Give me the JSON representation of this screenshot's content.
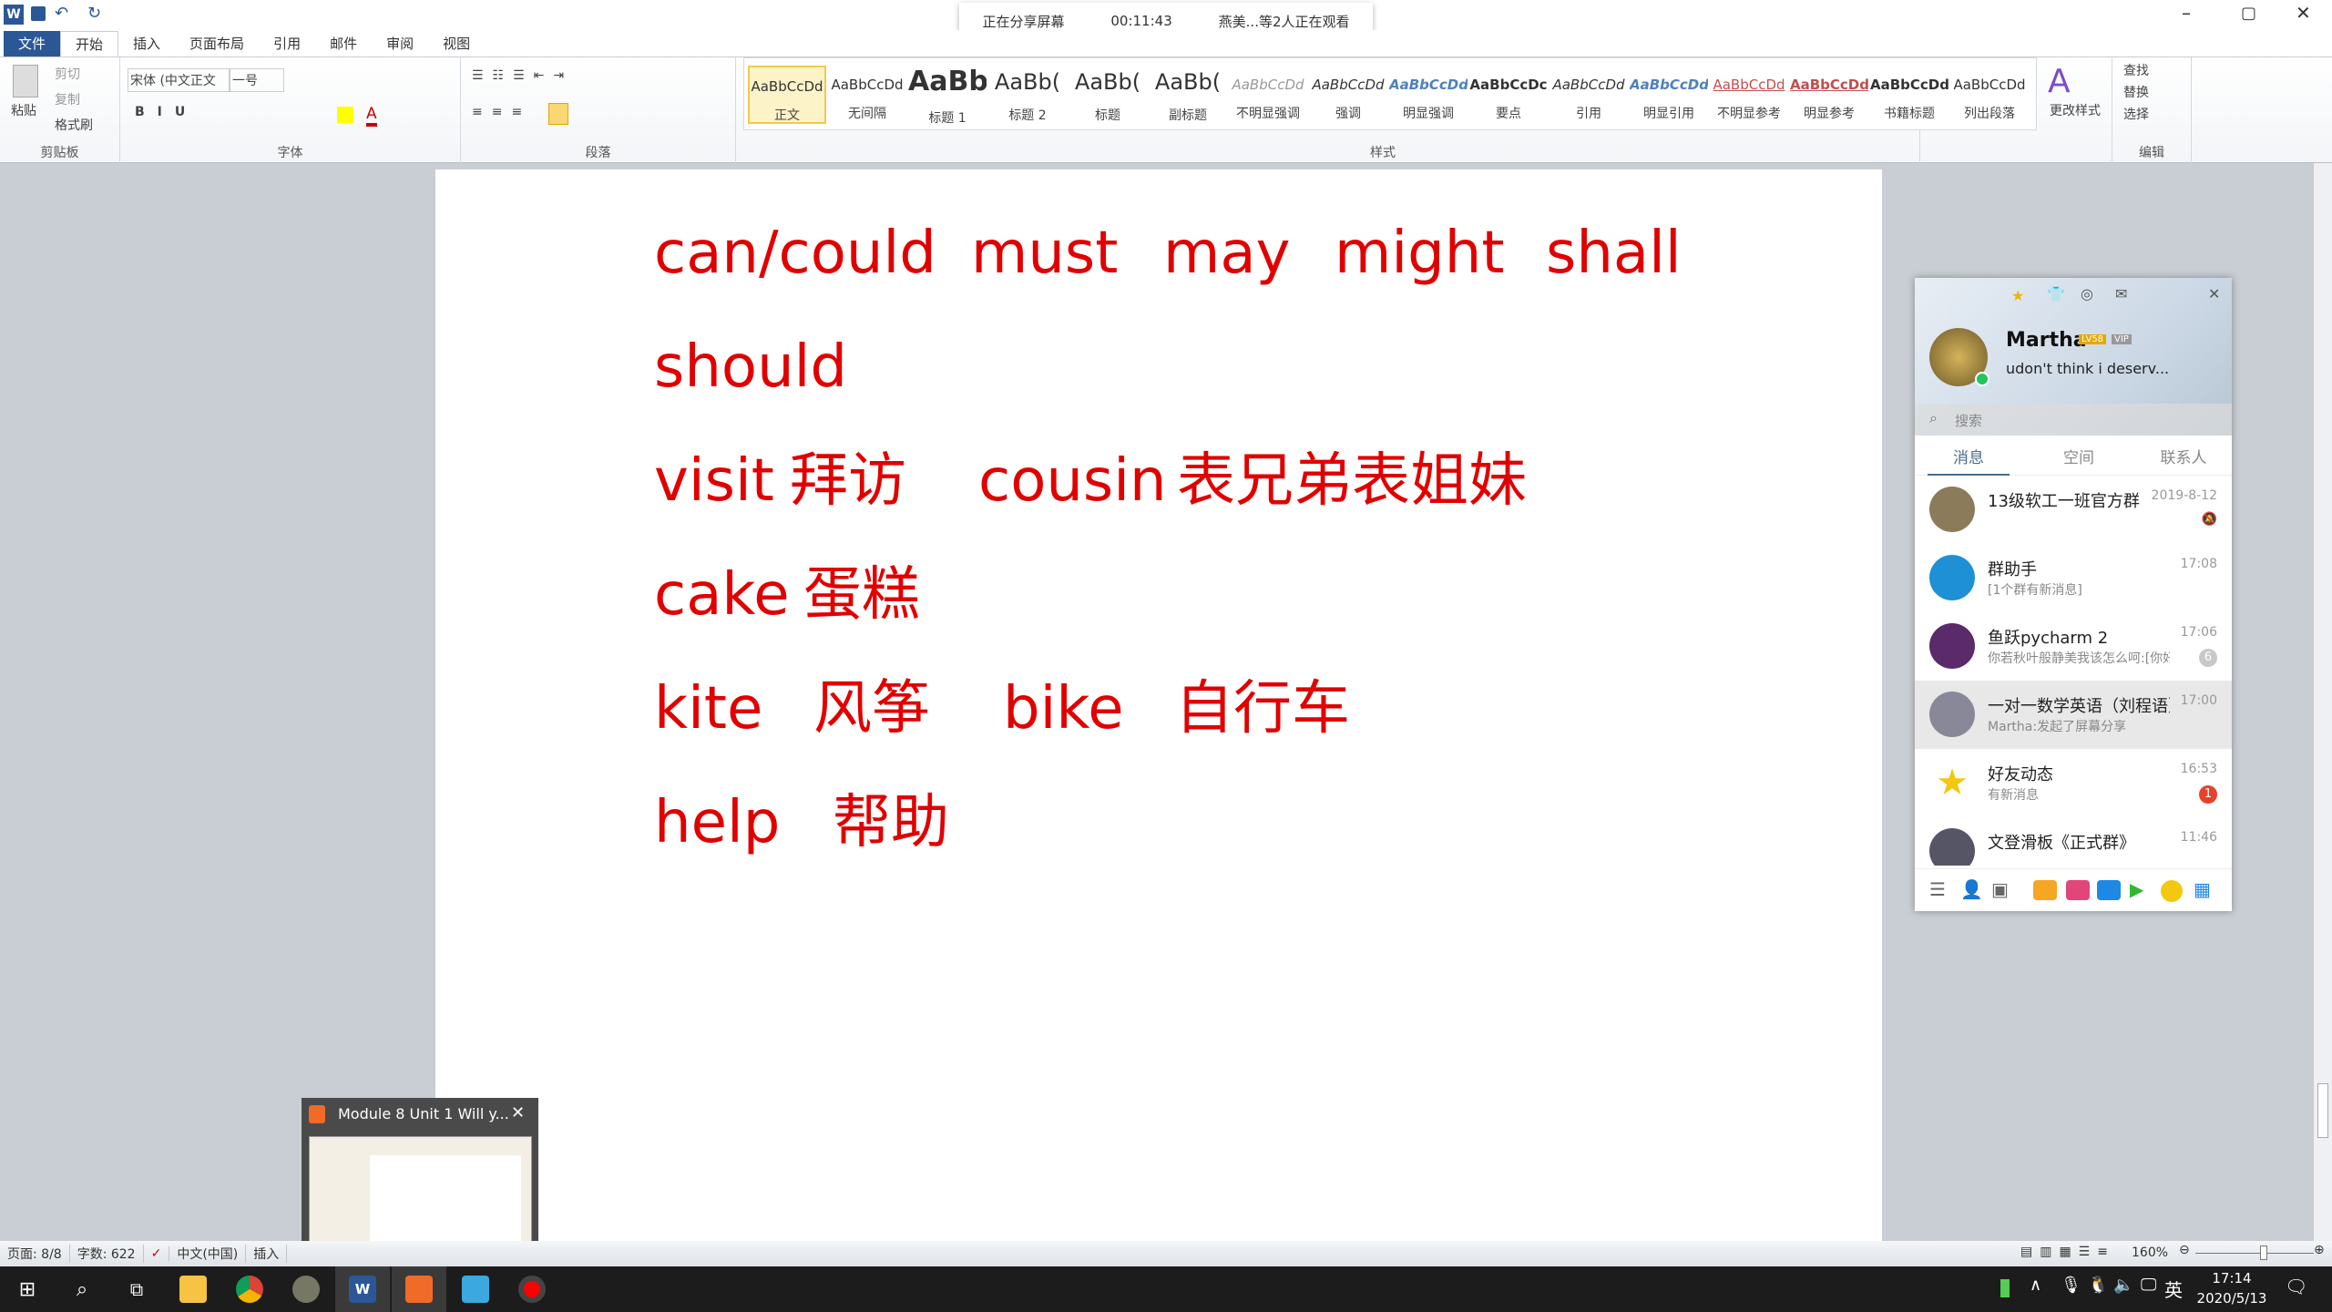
{
  "app": {
    "quick_access": [
      "save",
      "undo",
      "redo",
      "customize"
    ],
    "window_controls": [
      "minimize",
      "restore",
      "close"
    ]
  },
  "share_bar": {
    "status": "正在分享屏幕",
    "timer": "00:11:43",
    "viewers": "燕美...等2人正在观看"
  },
  "tabs": [
    {
      "label": "文件"
    },
    {
      "label": "开始",
      "active": true
    },
    {
      "label": "插入"
    },
    {
      "label": "页面布局"
    },
    {
      "label": "引用"
    },
    {
      "label": "邮件"
    },
    {
      "label": "审阅"
    },
    {
      "label": "视图"
    }
  ],
  "ribbon": {
    "clipboard": {
      "label": "剪贴板",
      "paste": "粘贴",
      "cut": "剪切",
      "copy": "复制",
      "format_painter": "格式刷"
    },
    "font": {
      "label": "字体",
      "font_name": "宋体 (中文正文",
      "font_size": "一号"
    },
    "paragraph": {
      "label": "段落"
    },
    "styles": {
      "label": "样式",
      "items": [
        {
          "sample": "AaBbCcDd",
          "name": "正文",
          "selected": true
        },
        {
          "sample": "AaBbCcDd",
          "name": "无间隔"
        },
        {
          "sample": "AaBb",
          "name": "标题 1"
        },
        {
          "sample": "AaBb(",
          "name": "标题 2"
        },
        {
          "sample": "AaBb(",
          "name": "标题"
        },
        {
          "sample": "AaBb(",
          "name": "副标题"
        },
        {
          "sample": "AaBbCcDd",
          "name": "不明显强调"
        },
        {
          "sample": "AaBbCcDd",
          "name": "强调"
        },
        {
          "sample": "AaBbCcDd",
          "name": "明显强调"
        },
        {
          "sample": "AaBbCcDc",
          "name": "要点"
        },
        {
          "sample": "AaBbCcDd",
          "name": "引用"
        },
        {
          "sample": "AaBbCcDd",
          "name": "明显引用"
        },
        {
          "sample": "AaBbCcDd",
          "name": "不明显参考"
        },
        {
          "sample": "AaBbCcDd",
          "name": "明显参考"
        },
        {
          "sample": "AaBbCcDd",
          "name": "书籍标题"
        },
        {
          "sample": "AaBbCcDd",
          "name": "列出段落"
        }
      ],
      "change_styles": "更改样式"
    },
    "editing": {
      "label": "编辑",
      "find": "查找",
      "replace": "替换",
      "select": "选择"
    }
  },
  "document": {
    "text_color": "#e00000",
    "lines": [
      [
        "can/could",
        "must",
        "may",
        "might",
        "shall"
      ],
      [
        "should"
      ],
      [
        "visit",
        "拜访",
        "cousin",
        "表兄弟表姐妹"
      ],
      [
        "cake",
        "蛋糕"
      ],
      [
        "kite",
        "风筝",
        "bike",
        "自行车"
      ],
      [
        "help",
        "帮助"
      ]
    ]
  },
  "qq": {
    "user": {
      "name": "Martha",
      "level": "LV58",
      "vip": "VIP",
      "signature": "udon't think i deserv..."
    },
    "search_placeholder": "搜索",
    "tabs": [
      {
        "label": "消息",
        "active": true
      },
      {
        "label": "空间"
      },
      {
        "label": "联系人"
      }
    ],
    "chats": [
      {
        "name": "13级软工一班官方群",
        "preview": "",
        "time": "2019-8-12",
        "muted": true
      },
      {
        "name": "群助手",
        "preview": "[1个群有新消息]",
        "time": "17:08"
      },
      {
        "name": "鱼跃pycharm 2",
        "preview": "你若秋叶般静美我该怎么呵:[你好",
        "time": "17:06",
        "badge": "6",
        "badge_color": "#c8c8c8"
      },
      {
        "name": "一对一数学英语（刘程语）",
        "preview": "Martha:发起了屏幕分享",
        "time": "17:00",
        "selected": true
      },
      {
        "name": "好友动态",
        "preview": "有新消息",
        "time": "16:53",
        "badge": "1",
        "badge_color": "#e8412c"
      },
      {
        "name": "文登滑板《正式群》",
        "preview": "",
        "time": "11:46"
      }
    ]
  },
  "thumbnail": {
    "title": "Module 8 Unit 1 Will y..."
  },
  "status_bar": {
    "page": "页面: 8/8",
    "words": "字数: 622",
    "language": "中文(中国)",
    "mode": "插入",
    "zoom": "160%",
    "zoom_percent": 160
  },
  "taskbar": {
    "apps": [
      "start",
      "search",
      "task-view",
      "file-explorer",
      "chrome",
      "qq-chat",
      "word",
      "ppt",
      "qq-screen",
      "recorder"
    ],
    "ime": "英",
    "time": "17:14",
    "date": "2020/5/13"
  }
}
